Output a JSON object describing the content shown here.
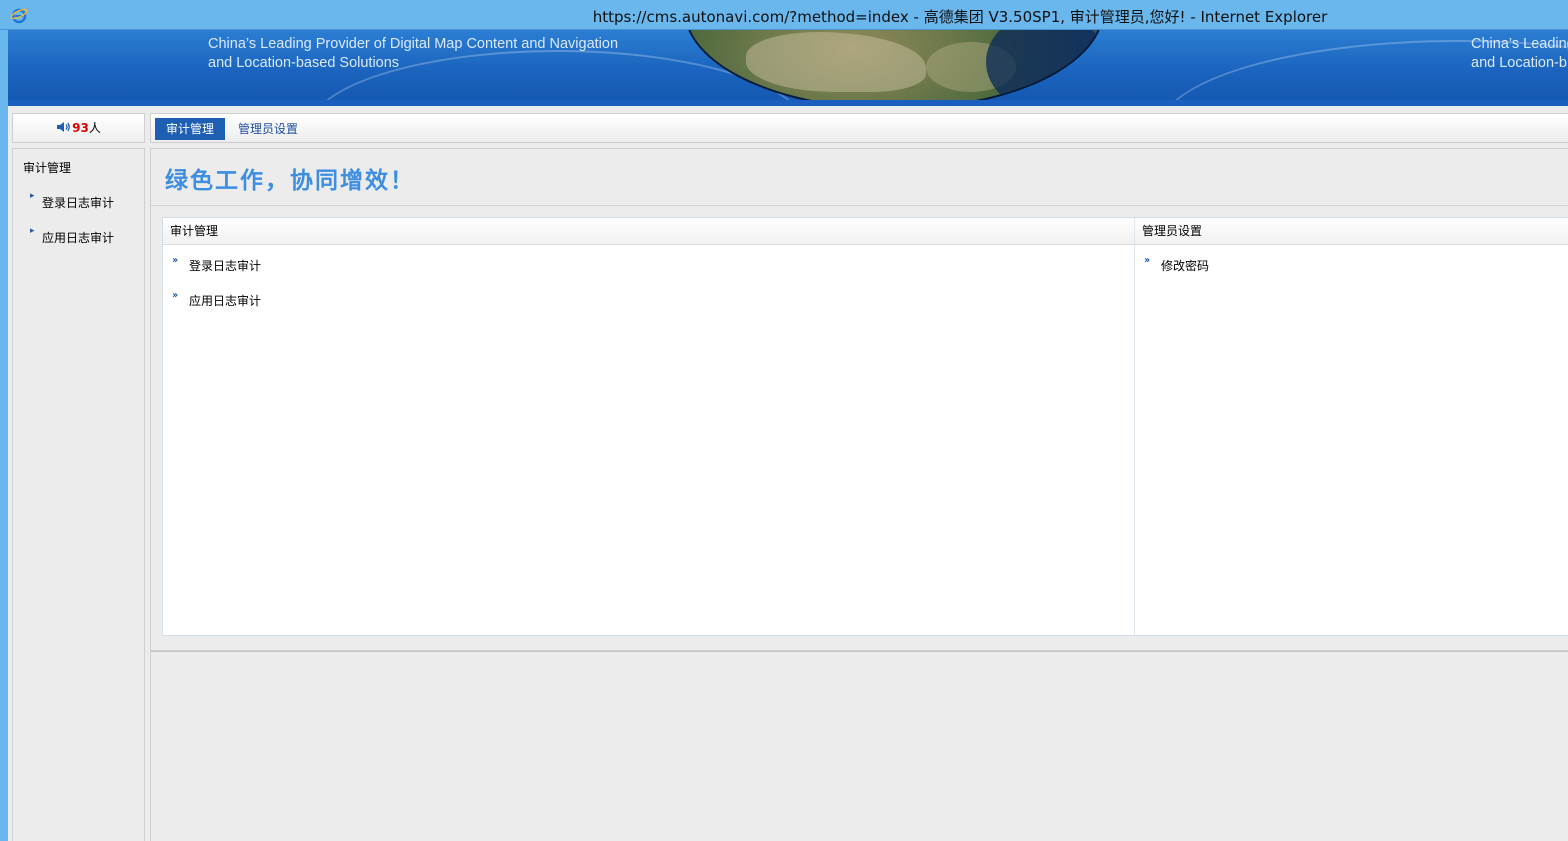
{
  "window": {
    "title": "https://cms.autonavi.com/?method=index - 高德集团 V3.50SP1, 审计管理员,您好! - Internet Explorer",
    "app_icon": "ie-icon"
  },
  "banner": {
    "tagline_line1": "China’s Leading Provider of Digital Map Content and Navigation",
    "tagline_line2": "and Location-based Solutions",
    "tagline_repeat_line1": "China’s Leading",
    "tagline_repeat_line2": "and Location-b"
  },
  "online": {
    "icon": "speaker-icon",
    "count": "93",
    "unit": "人",
    "count_color": "#e00000"
  },
  "tabs": [
    {
      "label": "审计管理",
      "active": true
    },
    {
      "label": "管理员设置",
      "active": false
    }
  ],
  "sidebar": {
    "title": "审计管理",
    "items": [
      {
        "label": "登录日志审计"
      },
      {
        "label": "应用日志审计"
      }
    ]
  },
  "main": {
    "slogan": "绿色工作，协同增效！",
    "cards": [
      {
        "header": "审计管理",
        "links": [
          {
            "label": "登录日志审计"
          },
          {
            "label": "应用日志审计"
          }
        ]
      },
      {
        "header": "管理员设置",
        "links": [
          {
            "label": "修改密码"
          }
        ]
      }
    ]
  },
  "colors": {
    "titlebar": "#6ab7ee",
    "banner": "#1b63be",
    "active_tab": "#1f5fb3",
    "slogan": "#3d8de0"
  }
}
